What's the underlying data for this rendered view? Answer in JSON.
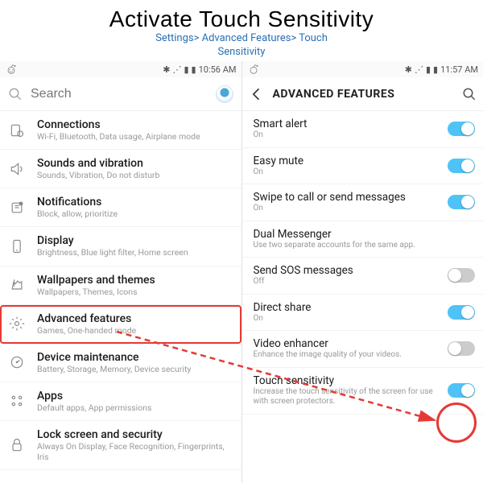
{
  "header": {
    "title": "Activate Touch Sensitivity",
    "breadcrumb_line1": "Settings> Advanced Features> Touch",
    "breadcrumb_line2": "Sensitivity"
  },
  "left": {
    "status_time": "10:56 AM",
    "search_placeholder": "Search",
    "items": [
      {
        "title": "Connections",
        "sub": "Wi-Fi, Bluetooth, Data usage, Airplane mode"
      },
      {
        "title": "Sounds and vibration",
        "sub": "Sounds, Vibration, Do not disturb"
      },
      {
        "title": "Notifications",
        "sub": "Block, allow, prioritize"
      },
      {
        "title": "Display",
        "sub": "Brightness, Blue light filter, Home screen"
      },
      {
        "title": "Wallpapers and themes",
        "sub": "Wallpapers, Themes, Icons"
      },
      {
        "title": "Advanced features",
        "sub": "Games, One-handed mode"
      },
      {
        "title": "Device maintenance",
        "sub": "Battery, Storage, Memory, Device security"
      },
      {
        "title": "Apps",
        "sub": "Default apps, App permissions"
      },
      {
        "title": "Lock screen and security",
        "sub": "Always On Display, Face Recognition, Fingerprints, Iris"
      }
    ]
  },
  "right": {
    "status_time": "11:57 AM",
    "screen_title": "ADVANCED FEATURES",
    "items": [
      {
        "title": "Smart alert",
        "sub": "On",
        "toggle": "on"
      },
      {
        "title": "Easy mute",
        "sub": "On",
        "toggle": "on"
      },
      {
        "title": "Swipe to call or send messages",
        "sub": "On",
        "toggle": "on"
      },
      {
        "title": "Dual Messenger",
        "sub": "Use two separate accounts for the same app.",
        "toggle": null
      },
      {
        "title": "Send SOS messages",
        "sub": "Off",
        "toggle": "off"
      },
      {
        "title": "Direct share",
        "sub": "On",
        "toggle": "on"
      },
      {
        "title": "Video enhancer",
        "sub": "Enhance the image quality of your videos.",
        "toggle": "off"
      },
      {
        "title": "Touch sensitivity",
        "sub": "Increase the touch sensitivity of the screen for use with screen protectors.",
        "toggle": "on"
      }
    ]
  }
}
